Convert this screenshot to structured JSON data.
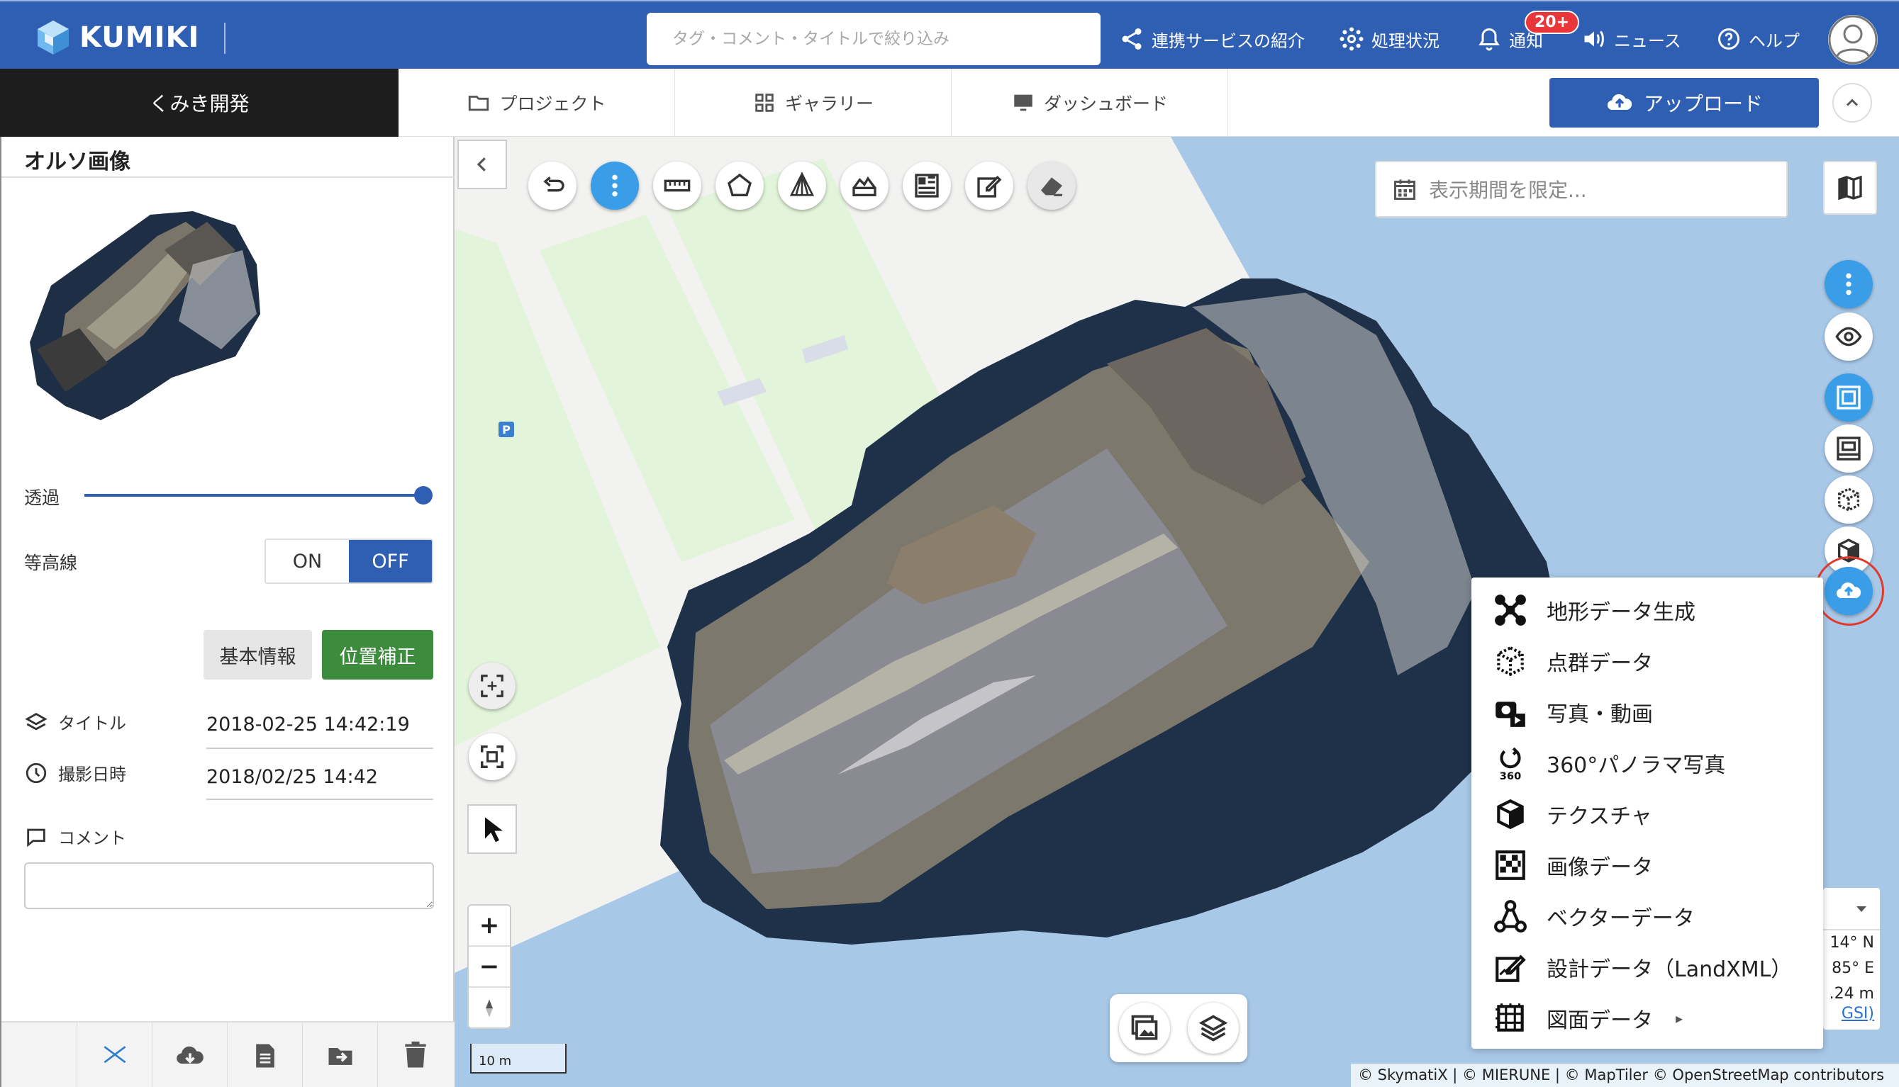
{
  "header": {
    "logo_text": "KUMIKI",
    "search_placeholder": "タグ・コメント・タイトルで絞り込み",
    "nav": {
      "services": "連携サービスの紹介",
      "processing": "処理状況",
      "notifications": "通知",
      "notification_badge": "20+",
      "news": "ニュース",
      "help": "ヘルプ"
    }
  },
  "subnav": {
    "project_name": "くみき開発",
    "tabs": {
      "project": "プロジェクト",
      "gallery": "ギャラリー",
      "dashboard": "ダッシュボード"
    },
    "upload_label": "アップロード"
  },
  "left_panel": {
    "title": "オルソ画像",
    "opacity_label": "透過",
    "opacity_value": 1.0,
    "contour_label": "等高線",
    "toggle_on": "ON",
    "toggle_off": "OFF",
    "basic_info_button": "基本情報",
    "position_fix_button": "位置補正",
    "title_label": "タイトル",
    "title_value": "2018-02-25 14:42:19",
    "date_label": "撮影日時",
    "date_value": "2018/02/25 14:42",
    "comment_label": "コメント",
    "comment_value": ""
  },
  "map": {
    "date_filter_placeholder": "表示期間を限定...",
    "scale_label": "10 m",
    "attribution_prefix": "© SkymatiX | © MIERUNE | © MapTiler © OpenStreetMap contributors",
    "coords": {
      "lat": "14° N",
      "lon": "85° E",
      "alt": ".24 m",
      "src": "GSI)"
    },
    "parking_label": "P"
  },
  "upload_menu": {
    "items": [
      {
        "label": "地形データ生成",
        "icon": "drone-icon"
      },
      {
        "label": "点群データ",
        "icon": "point-cloud-icon"
      },
      {
        "label": "写真・動画",
        "icon": "camera-icon"
      },
      {
        "label": "360°パノラマ写真",
        "icon": "panorama-360-icon",
        "icon_text": "360"
      },
      {
        "label": "テクスチャ",
        "icon": "texture-cube-icon"
      },
      {
        "label": "画像データ",
        "icon": "image-grid-icon"
      },
      {
        "label": "ベクターデータ",
        "icon": "vector-icon"
      },
      {
        "label": "設計データ（LandXML）",
        "icon": "design-edit-icon"
      },
      {
        "label": "図面データ",
        "icon": "drawing-icon",
        "has_submenu": true
      }
    ]
  },
  "colors": {
    "header_bg": "#2f5fb3",
    "accent_blue": "#3a9de8",
    "green": "#3d8b3d",
    "highlight_red": "#e03a2a"
  }
}
